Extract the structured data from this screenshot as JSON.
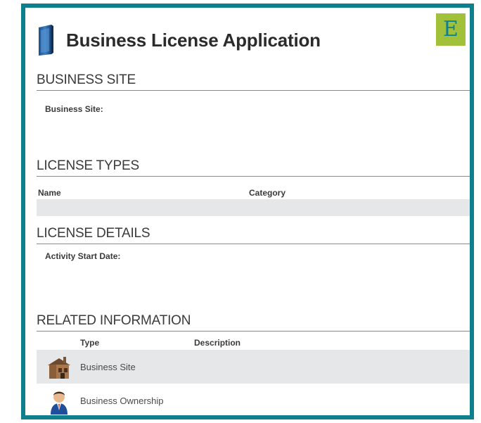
{
  "header": {
    "title": "Business License Application",
    "icon": "form-icon",
    "badge": "E"
  },
  "business_site": {
    "title": "BUSINESS SITE",
    "field_label": "Business Site:"
  },
  "license_types": {
    "title": "LICENSE TYPES",
    "columns": [
      "Name",
      "Category"
    ]
  },
  "license_details": {
    "title": "LICENSE DETAILS",
    "field_label": "Activity Start Date:"
  },
  "related_information": {
    "title": "RELATED INFORMATION",
    "columns": [
      "Type",
      "Description"
    ],
    "rows": [
      {
        "icon": "building-icon",
        "type": "Business Site"
      },
      {
        "icon": "person-icon",
        "type": "Business Ownership"
      }
    ]
  },
  "colors": {
    "frame": "#0e7f8d",
    "badge": "#a2c13a",
    "row_shade": "#e6e7e8"
  }
}
